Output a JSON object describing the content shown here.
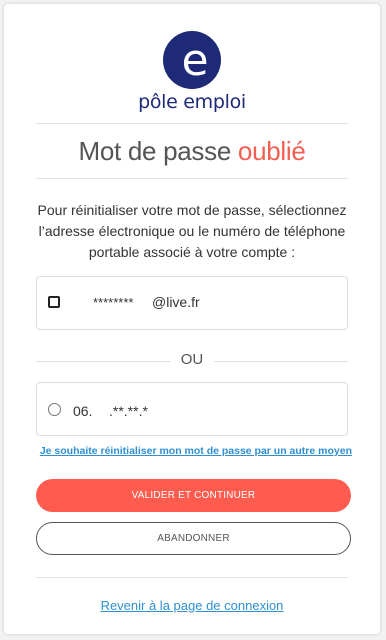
{
  "brand": {
    "name": "pôle emploi",
    "logo_letter": "e",
    "navy": "#1e2a78",
    "accent": "#f25e4f"
  },
  "title": {
    "part1": "Mot de passe ",
    "part2": "oublié"
  },
  "instructions": "Pour réinitialiser votre mot de passe, sélectionnez l’adresse électronique ou le numéro de téléphone portable associé à votre compte :",
  "options": {
    "email": {
      "masked_prefix": "********",
      "domain": "@live.fr",
      "control": "checkbox-icon"
    },
    "separator": "OU",
    "phone": {
      "prefix": "06.",
      "masked": ".**.**.*",
      "control": "radio-icon"
    }
  },
  "alt_link": "Je souhaite réinitialiser mon mot de passe par un autre moyen",
  "buttons": {
    "validate": "VALIDER ET CONTINUER",
    "cancel": "ABANDONNER"
  },
  "back_link": "Revenir à la page de connexion"
}
